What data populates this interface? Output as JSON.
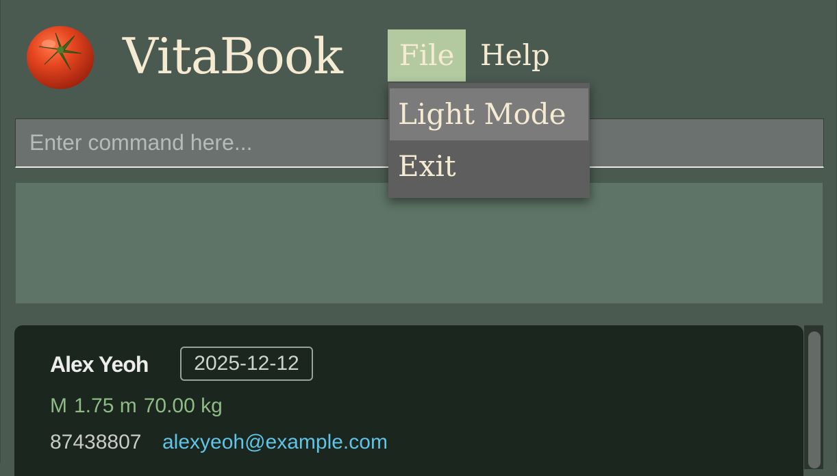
{
  "app": {
    "title": "VitaBook",
    "logo_icon": "tomato-icon"
  },
  "menu_bar": {
    "file_label": "File",
    "help_label": "Help",
    "active_menu": "File",
    "active_color": "#b3c9a0"
  },
  "file_menu": {
    "items": [
      {
        "label": "Light Mode",
        "highlighted": true
      },
      {
        "label": "Exit",
        "highlighted": false
      }
    ]
  },
  "command_box": {
    "value": "",
    "placeholder": "Enter command here..."
  },
  "result_display": {
    "text": ""
  },
  "person_list": {
    "persons": [
      {
        "name": "Alex Yeoh",
        "date": "2025-12-12",
        "gender": "M",
        "height": "1.75 m",
        "weight": "70.00 kg",
        "phone": "87438807",
        "email": "alexyeoh@example.com"
      }
    ]
  },
  "colors": {
    "background": "#4a5a50",
    "title_text": "#f5ead2",
    "card_background": "#1a261e",
    "stats_text": "#8fbb85",
    "email_text": "#5fc4e6"
  }
}
